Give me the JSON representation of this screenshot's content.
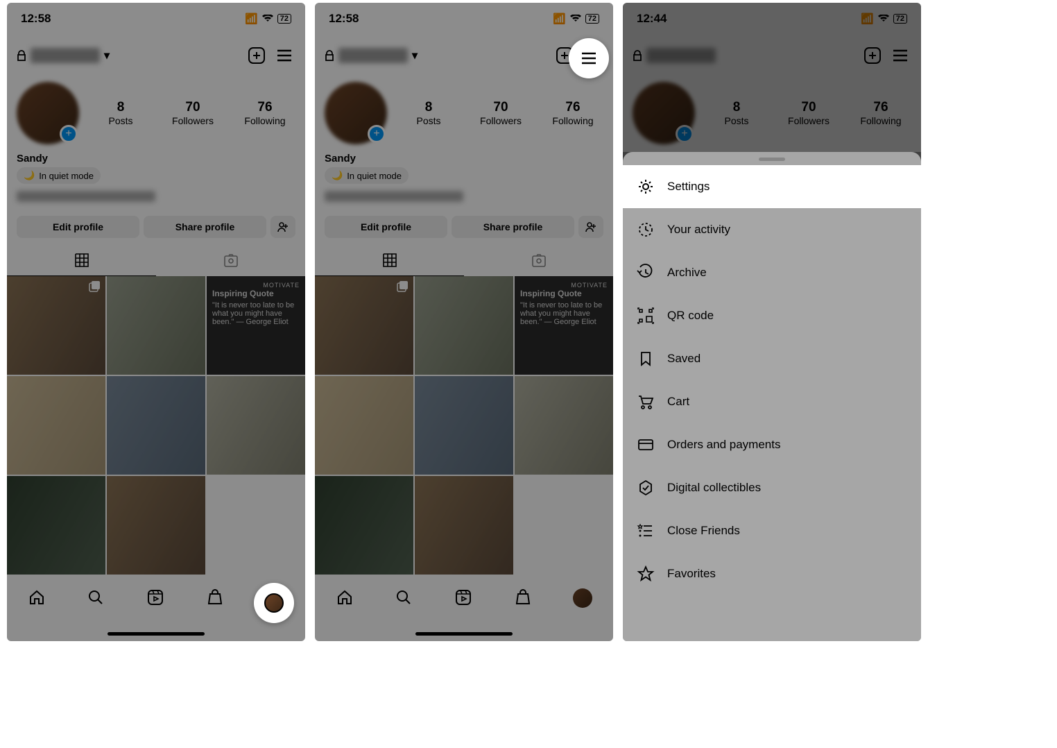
{
  "status": {
    "time": "12:58",
    "time_alt": "12:44",
    "battery": "72"
  },
  "profile": {
    "display_name": "Sandy",
    "quiet_mode": "In quiet mode",
    "posts_count": "8",
    "posts_label": "Posts",
    "followers_count": "70",
    "followers_label": "Followers",
    "following_count": "76",
    "following_label": "Following",
    "edit_label": "Edit profile",
    "share_label": "Share profile"
  },
  "quote": {
    "badge_top": "MOTIVATE",
    "title": "Inspiring Quote",
    "body": "\"It is never too late to be what you might have been.\" — George Eliot"
  },
  "menu": {
    "settings": "Settings",
    "activity": "Your activity",
    "archive": "Archive",
    "qr": "QR code",
    "saved": "Saved",
    "cart": "Cart",
    "orders": "Orders and payments",
    "collectibles": "Digital collectibles",
    "closefriends": "Close Friends",
    "favorites": "Favorites"
  }
}
